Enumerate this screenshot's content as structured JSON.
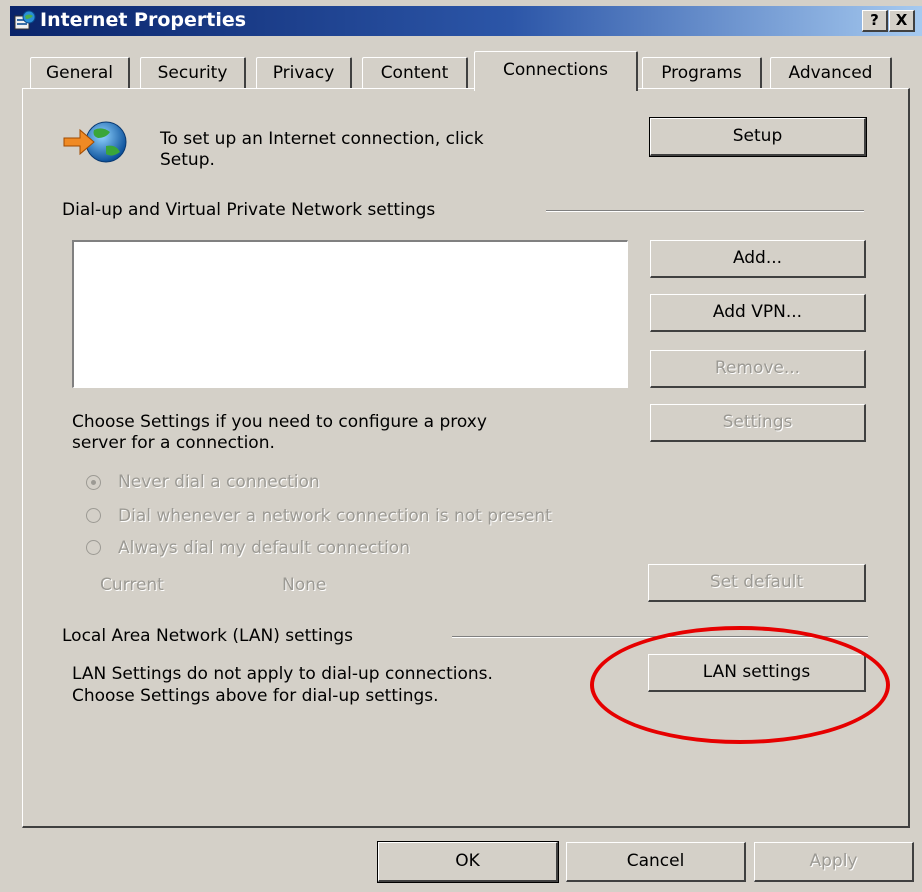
{
  "window": {
    "title": "Internet Properties",
    "help_button": "?",
    "close_button": "X"
  },
  "tabs": [
    {
      "label": "General",
      "active": false
    },
    {
      "label": "Security",
      "active": false
    },
    {
      "label": "Privacy",
      "active": false
    },
    {
      "label": "Content",
      "active": false
    },
    {
      "label": "Connections",
      "active": true
    },
    {
      "label": "Programs",
      "active": false
    },
    {
      "label": "Advanced",
      "active": false
    }
  ],
  "setup": {
    "text_line1": "To set up an Internet connection, click",
    "text_line2": "Setup.",
    "button": "Setup"
  },
  "dialup": {
    "group_label": "Dial-up and Virtual Private Network settings",
    "add_button": "Add...",
    "add_vpn_button": "Add VPN...",
    "remove_button": "Remove...",
    "settings_button": "Settings",
    "proxy_text_line1": "Choose Settings if you need to configure a proxy",
    "proxy_text_line2": "server for a connection.",
    "radio_never": "Never dial a connection",
    "radio_whenever": "Dial whenever a network connection is not present",
    "radio_always": "Always dial my default connection",
    "current_label": "Current",
    "current_value": "None",
    "set_default_button": "Set default"
  },
  "lan": {
    "group_label": "Local Area Network (LAN) settings",
    "text_line1": "LAN Settings do not apply to dial-up connections.",
    "text_line2": "Choose Settings above for dial-up settings.",
    "button": "LAN settings"
  },
  "footer": {
    "ok": "OK",
    "cancel": "Cancel",
    "apply": "Apply"
  },
  "colors": {
    "highlight_ellipse": "#e60000",
    "titlebar_start": "#0a246a",
    "titlebar_end": "#a6caf0"
  },
  "icons": {
    "title": "internet-options-icon",
    "setup": "globe-arrow-icon"
  }
}
